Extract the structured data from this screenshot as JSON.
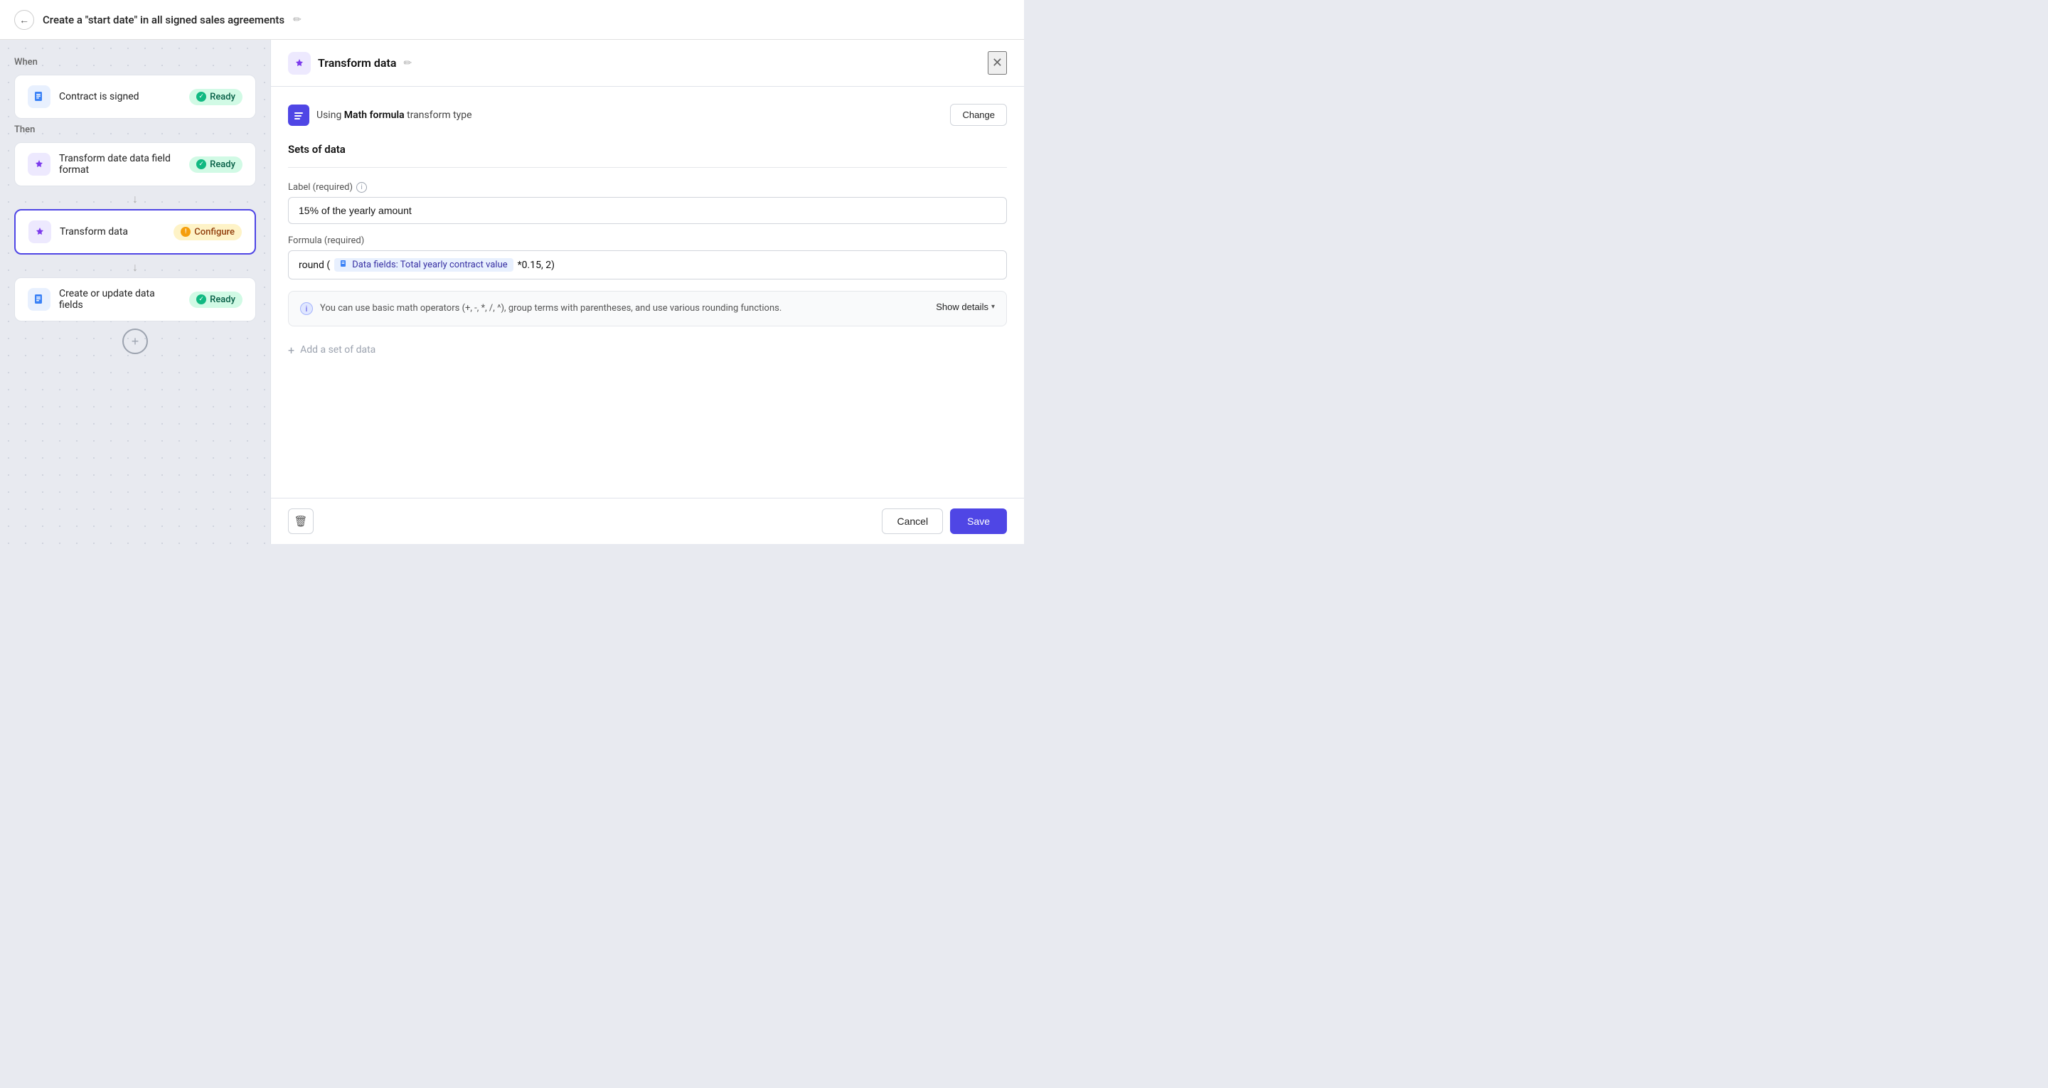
{
  "topBar": {
    "title": "Create a \"start date\" in all signed sales agreements",
    "backLabel": "←",
    "editIconLabel": "✏"
  },
  "leftPanel": {
    "whenLabel": "When",
    "thenLabel": "Then",
    "cards": [
      {
        "id": "contract-signed",
        "label": "Contract is signed",
        "iconType": "blue",
        "iconChar": "📄",
        "badgeType": "ready",
        "badgeLabel": "Ready",
        "active": false
      },
      {
        "id": "transform-date",
        "label": "Transform date data field format",
        "iconType": "purple",
        "iconChar": "✦",
        "badgeType": "ready",
        "badgeLabel": "Ready",
        "active": false
      },
      {
        "id": "transform-data",
        "label": "Transform data",
        "iconType": "purple",
        "iconChar": "✦",
        "badgeType": "configure",
        "badgeLabel": "Configure",
        "active": true
      },
      {
        "id": "create-update",
        "label": "Create or update data fields",
        "iconType": "blue",
        "iconChar": "📄",
        "badgeType": "ready",
        "badgeLabel": "Ready",
        "active": false
      }
    ],
    "addButtonLabel": "+"
  },
  "rightPanel": {
    "title": "Transform data",
    "transformTypeText": "Using",
    "transformTypeBold": "Math formula",
    "transformTypeAfter": "transform type",
    "changeLabel": "Change",
    "setsTitle": "Sets of data",
    "labelFieldLabel": "Label (required)",
    "labelFieldValue": "15% of the yearly amount",
    "formulaFieldLabel": "Formula (required)",
    "formulaPrefix": "round ( ",
    "formulaTag": "Data fields: Total yearly contract value",
    "formulaSuffix": " *0.15, 2)",
    "infoText": "You can use basic math operators (+, -, *, /, ^), group terms with parentheses, and use various rounding functions.",
    "showDetailsLabel": "Show details",
    "addSetLabel": "Add a set of data",
    "deleteIconLabel": "🗑",
    "cancelLabel": "Cancel",
    "saveLabel": "Save"
  }
}
